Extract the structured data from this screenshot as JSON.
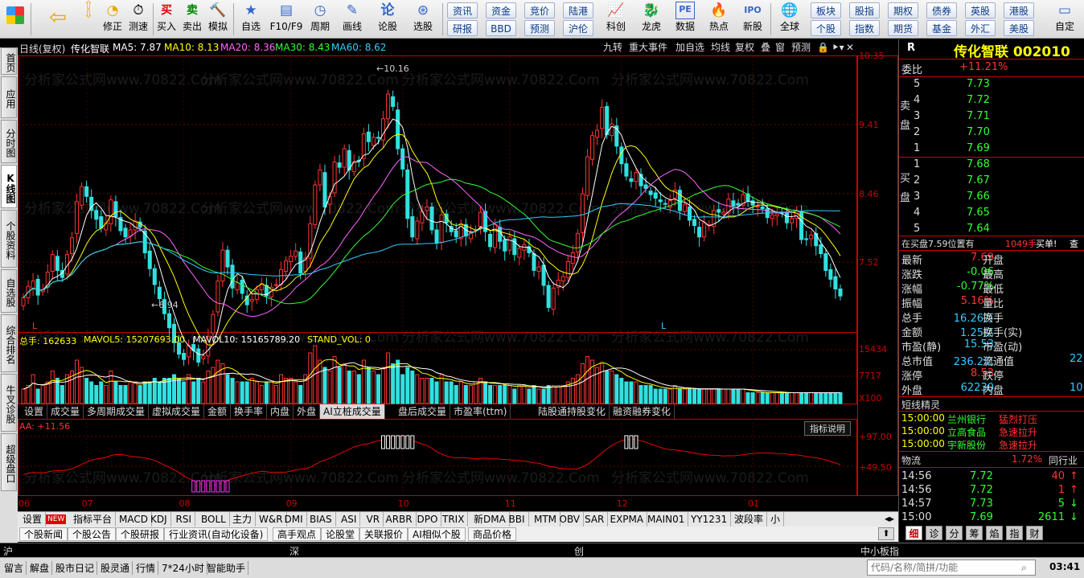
{
  "toolbar": {
    "items": [
      {
        "name": "logo",
        "label": "",
        "icon": "windows-logo"
      },
      {
        "name": "back",
        "label": "",
        "icon": "back-arrow"
      },
      {
        "name": "up-down",
        "label": "修正",
        "icon": "up-down-arrows"
      },
      {
        "name": "fix",
        "label": "修正",
        "icon": "fix-icon"
      },
      {
        "name": "timer",
        "label": "测速",
        "icon": "clock"
      },
      {
        "name": "buy",
        "label": "买入",
        "icon": "buy"
      },
      {
        "name": "sell",
        "label": "卖出",
        "icon": "sell"
      },
      {
        "name": "simulate",
        "label": "模拟",
        "icon": "hammer"
      },
      {
        "name": "watchlist",
        "label": "自选",
        "icon": "star"
      },
      {
        "name": "f10",
        "label": "F10/F9",
        "icon": "f10"
      },
      {
        "name": "period",
        "label": "周期",
        "icon": "clock"
      },
      {
        "name": "draw",
        "label": "画线",
        "icon": "pen"
      },
      {
        "name": "forum",
        "label": "论股",
        "icon": "chat"
      },
      {
        "name": "select",
        "label": "选股",
        "icon": "chart"
      }
    ],
    "quick": [
      "资讯",
      "资金",
      "竞价",
      "陆港",
      "研报",
      "BBD",
      "预测",
      "沪伦"
    ],
    "items2": [
      {
        "name": "kechuang",
        "label": "科创",
        "icon": "kechuang"
      },
      {
        "name": "longhu",
        "label": "龙虎",
        "icon": "dragon"
      },
      {
        "name": "data",
        "label": "数据",
        "icon": "pe"
      },
      {
        "name": "hot",
        "label": "热点",
        "icon": "fire"
      },
      {
        "name": "ipo",
        "label": "新股",
        "icon": "ipo"
      },
      {
        "name": "global",
        "label": "全球",
        "icon": "globe"
      }
    ],
    "quick2": [
      "板块",
      "股指",
      "期权",
      "债券",
      "英股",
      "港股",
      "个股",
      "指数",
      "期货",
      "基金",
      "外汇",
      "美股"
    ],
    "custom": "自定"
  },
  "sidebar": [
    "首页",
    "应用",
    "分时图",
    "K线图",
    "个股资料",
    "自选股",
    "综合排名",
    "牛叉诊股",
    "超级盘口"
  ],
  "chart": {
    "header": {
      "title": "日线(复权)",
      "name": "传化智联",
      "ma5": "MA5: 7.87",
      "ma10": "MA10: 8.13",
      "ma20": "MA20: 8.36",
      "ma30": "MA30: 8.43",
      "ma60": "MA60: 8.62"
    },
    "buttons": [
      "九转",
      "重大事件",
      "加自选",
      "均线",
      "复权",
      "叠",
      "窗",
      "预测"
    ],
    "price_ticks": [
      "10.35",
      "9.41",
      "8.46",
      "7.52"
    ],
    "vol_ticks": [
      "15434",
      "7717",
      "X100"
    ],
    "ind_ticks": [
      "97.00",
      "49.50"
    ],
    "high_label": "10.16",
    "low_label": "6.94",
    "vol_header": {
      "total": "总手: 162633",
      "mavol5": "MAVOL5: 15207693.00",
      "mavol10": "MAVOL10: 15165789.20",
      "stand": "STAND_VOL: 0"
    },
    "ind_header": "AA: +11.56",
    "ind_explain": "指标说明",
    "watermark": "分析家公式网www.70822.Com",
    "month_labels": [
      "06",
      "07",
      "08",
      "09",
      "10",
      "11",
      "12",
      "01"
    ],
    "L_marks": [
      "L",
      "L"
    ],
    "colors": {
      "up": "#ff3333",
      "down": "#33e0e0",
      "ma5": "#ffffff",
      "ma10": "#ffff00",
      "ma20": "#ff66ff",
      "ma30": "#33ff33",
      "ma60": "#33ccff"
    }
  },
  "chart_data": {
    "type": "candlestick",
    "title": "日线(复权)",
    "symbol": "传化智联 002010",
    "ylim": [
      7.3,
      10.4
    ],
    "x": [
      "06",
      "07",
      "08",
      "09",
      "10",
      "11",
      "12",
      "01"
    ],
    "series": [
      {
        "name": "MA5",
        "values": [
          7.87
        ]
      },
      {
        "name": "MA10",
        "values": [
          8.13
        ]
      },
      {
        "name": "MA20",
        "values": [
          8.36
        ]
      },
      {
        "name": "MA30",
        "values": [
          8.43
        ]
      },
      {
        "name": "MA60",
        "values": [
          8.62
        ]
      }
    ],
    "close": [
      7.67,
      7.8,
      7.86,
      7.7,
      7.76,
      7.96,
      8.16,
      7.98,
      7.9,
      8.16,
      8.35,
      8.76,
      8.93,
      8.82,
      8.66,
      8.56,
      8.46,
      8.52,
      8.78,
      8.59,
      8.43,
      8.36,
      8.44,
      8.54,
      8.47,
      8.18,
      8.0,
      7.82,
      7.66,
      7.49,
      7.33,
      7.16,
      7.03,
      6.97,
      7.13,
      7.07,
      6.94,
      7.01,
      7.23,
      7.48,
      7.86,
      8.21,
      8.02,
      7.78,
      7.84,
      7.72,
      7.59,
      7.65,
      7.76,
      7.83,
      7.69,
      7.79,
      7.82,
      7.99,
      8.09,
      8.14,
      8.2,
      7.95,
      8.12,
      8.51,
      8.95,
      9.12,
      8.7,
      8.82,
      9.21,
      9.15,
      9.36,
      9.12,
      9.21,
      9.22,
      9.53,
      9.44,
      9.49,
      9.48,
      9.7,
      9.98,
      9.84,
      9.36,
      9.13,
      8.57,
      8.36,
      8.54,
      8.65,
      8.7,
      8.44,
      8.29,
      8.61,
      8.52,
      8.42,
      8.36,
      8.51,
      8.37,
      8.41,
      8.44,
      8.64,
      8.42,
      8.25,
      8.5,
      8.31,
      8.2,
      8.36,
      8.16,
      8.23,
      8.27,
      8.18,
      7.98,
      8.02,
      7.81,
      7.56,
      7.78,
      7.87,
      7.91,
      8.08,
      8.18,
      8.4,
      8.85,
      9.27,
      9.51,
      9.57,
      9.83,
      9.52,
      9.64,
      9.39,
      9.19,
      9.05,
      8.99,
      9.09,
      8.94,
      8.91,
      8.84,
      8.8,
      8.76,
      8.73,
      8.77,
      8.89,
      8.66,
      8.73,
      8.55,
      8.49,
      8.36,
      8.52,
      8.5,
      8.66,
      8.64,
      8.64,
      8.79,
      8.71,
      8.72,
      8.84,
      8.77,
      8.72,
      8.71,
      8.68,
      8.58,
      8.61,
      8.62,
      8.63,
      8.52,
      8.57,
      8.66,
      8.33,
      8.33,
      8.38,
      8.26,
      8.17,
      7.98,
      7.88,
      7.77,
      7.69
    ],
    "open": [
      7.58,
      7.67,
      7.78,
      7.88,
      7.74,
      7.79,
      7.97,
      8.14,
      7.98,
      7.94,
      8.17,
      8.4,
      8.72,
      8.93,
      8.81,
      8.66,
      8.59,
      8.44,
      8.51,
      8.76,
      8.58,
      8.46,
      8.37,
      8.44,
      8.53,
      8.43,
      8.2,
      8.0,
      7.79,
      7.65,
      7.49,
      7.37,
      7.16,
      7.04,
      7.0,
      7.14,
      7.09,
      6.98,
      7.01,
      7.27,
      7.51,
      7.86,
      8.21,
      8.04,
      7.76,
      7.87,
      7.69,
      7.63,
      7.65,
      7.76,
      7.81,
      7.68,
      7.81,
      7.82,
      7.97,
      8.08,
      8.14,
      8.19,
      7.97,
      8.12,
      8.5,
      8.95,
      9.09,
      8.73,
      8.86,
      9.2,
      9.15,
      9.34,
      9.1,
      9.23,
      9.25,
      9.55,
      9.4,
      9.49,
      9.46,
      9.7,
      9.95,
      9.8,
      9.36,
      9.12,
      8.59,
      8.34,
      8.52,
      8.66,
      8.7,
      8.44,
      8.3,
      8.62,
      8.48,
      8.43,
      8.34,
      8.5,
      8.34,
      8.43,
      8.48,
      8.65,
      8.39,
      8.24,
      8.47,
      8.33,
      8.21,
      8.34,
      8.13,
      8.21,
      8.25,
      8.17,
      7.97,
      8.04,
      7.81,
      7.54,
      7.79,
      7.86,
      7.9,
      8.06,
      8.19,
      8.41,
      8.83,
      9.24,
      9.49,
      9.59,
      9.84,
      9.51,
      9.62,
      9.38,
      9.19,
      9.02,
      8.99,
      9.07,
      8.95,
      8.88,
      8.86,
      8.78,
      8.74,
      8.7,
      8.8,
      8.89,
      8.65,
      8.7,
      8.56,
      8.47,
      8.36,
      8.5,
      8.48,
      8.67,
      8.62,
      8.63,
      8.77,
      8.74,
      8.72,
      8.85,
      8.77,
      8.7,
      8.7,
      8.68,
      8.57,
      8.6,
      8.64,
      8.63,
      8.52,
      8.57,
      8.65,
      8.34,
      8.34,
      8.4,
      8.27,
      8.17,
      7.99,
      7.91,
      7.77
    ],
    "volume": [
      4,
      5,
      8,
      4,
      5,
      6,
      9,
      7,
      5,
      8,
      9,
      12,
      10,
      7,
      6,
      5,
      6,
      5,
      9,
      6,
      5,
      5,
      6,
      6,
      5,
      6,
      6,
      7,
      6,
      7,
      7,
      8,
      7,
      6,
      8,
      6,
      7,
      6,
      9,
      10,
      12,
      11,
      8,
      7,
      6,
      6,
      6,
      7,
      6,
      5,
      6,
      6,
      5,
      8,
      7,
      7,
      6,
      5,
      8,
      14,
      16,
      12,
      10,
      9,
      13,
      10,
      11,
      9,
      9,
      8,
      12,
      10,
      9,
      8,
      10,
      14,
      11,
      12,
      8,
      10,
      9,
      8,
      7,
      7,
      7,
      6,
      8,
      6,
      6,
      5,
      6,
      5,
      5,
      6,
      7,
      6,
      5,
      5,
      5,
      5,
      5,
      4,
      5,
      5,
      4,
      5,
      4,
      4,
      5,
      5,
      5,
      5,
      6,
      7,
      8,
      11,
      13,
      12,
      10,
      11,
      9,
      9,
      8,
      7,
      6,
      6,
      6,
      5,
      5,
      5,
      4,
      4,
      4,
      4,
      5,
      4,
      4,
      4,
      4,
      4,
      4,
      4,
      4,
      4,
      4,
      4,
      4,
      4,
      4,
      3,
      3,
      3,
      3,
      3,
      3,
      3,
      3,
      3,
      3,
      3,
      3,
      3,
      3,
      3,
      3,
      3,
      3,
      3,
      3
    ],
    "indicator": {
      "name": "AA",
      "last": 11.56,
      "levels": [
        97.0,
        49.5
      ]
    }
  },
  "tabs1": [
    "设置",
    "成交量",
    "多周期成交量",
    "虚拟成交量",
    "金额",
    "换手率",
    "内盘",
    "外盘",
    "AI立桩成交量",
    "盘后成交量",
    "市盈率(ttm)",
    "陆股通持股变化",
    "融资融券变化"
  ],
  "tabs1_active": "AI立桩成交量",
  "tabs2": [
    "设置",
    "指标平台",
    "MACD",
    "KDJ",
    "RSI",
    "BOLL",
    "主力",
    "W&R",
    "DMI",
    "BIAS",
    "ASI",
    "VR",
    "ARBR",
    "DPO",
    "TRIX",
    "新DMA",
    "BBI",
    "MTM",
    "OBV",
    "SAR",
    "EXPMA",
    "MAIN01",
    "YY1231",
    "波段率",
    "小"
  ],
  "tabs2_new": "NEW",
  "tabs3": [
    "个股新闻",
    "个股公告",
    "个股研报",
    "行业资讯(自动化设备)",
    "高手观点",
    "论股堂",
    "关联报价",
    "AI相似个股",
    "商品价格"
  ],
  "idxbar": [
    "沪",
    "深",
    "创",
    "中小板指"
  ],
  "statusbar": [
    "留言",
    "解盘",
    "股市日记",
    "股灵通",
    "行情",
    "7*24小时",
    "智能助手"
  ],
  "search_placeholder": "代码/名称/简拼/功能",
  "clock": "03:41",
  "rpanel": {
    "title": "传化智联 002010",
    "weibi_label": "委比",
    "weibi_value": "+11.21%",
    "sell_label": "卖盘",
    "sell": [
      [
        "5",
        "7.73"
      ],
      [
        "4",
        "7.72"
      ],
      [
        "3",
        "7.71"
      ],
      [
        "2",
        "7.70"
      ],
      [
        "1",
        "7.69"
      ]
    ],
    "buy_label": "买盘",
    "buy": [
      [
        "1",
        "7.68"
      ],
      [
        "2",
        "7.67"
      ],
      [
        "3",
        "7.66"
      ],
      [
        "4",
        "7.65"
      ],
      [
        "5",
        "7.64"
      ]
    ],
    "notice": "在买盘7.59位置有",
    "notice_qty": "1049手",
    "notice_type": "买单!",
    "notice_more": "查",
    "quote": [
      [
        "最新",
        "7.69",
        "开盘",
        ""
      ],
      [
        "涨跌",
        "-0.06",
        "最高",
        ""
      ],
      [
        "涨幅",
        "-0.77%",
        "最低",
        ""
      ],
      [
        "振幅",
        "5.16%",
        "量比",
        ""
      ],
      [
        "总手",
        "16.26万",
        "换手",
        ""
      ],
      [
        "金额",
        "1.25亿",
        "换手(实)",
        ""
      ],
      [
        "市盈(静)",
        "15.53",
        "市盈(动)",
        ""
      ],
      [
        "总市值",
        "236.2亿",
        "流通值",
        "22"
      ],
      [
        "涨停",
        "8.53",
        "跌停",
        ""
      ],
      [
        "外盘",
        "62230",
        "内盘",
        "10"
      ]
    ],
    "elves_title": "短线精灵",
    "elves": [
      [
        "15:00:00",
        "兰州银行",
        "猛烈打压"
      ],
      [
        "15:00:00",
        "立高食品",
        "急速拉升"
      ],
      [
        "15:00:00",
        "宇新股份",
        "急速拉升"
      ]
    ],
    "industry_label": "物流",
    "industry_pct": "1.72%",
    "industry_btn": "同行业",
    "ticks": [
      [
        "14:56",
        "7.72",
        "40",
        "up"
      ],
      [
        "14:56",
        "7.72",
        "1",
        "up"
      ],
      [
        "14:57",
        "7.73",
        "5",
        "down"
      ],
      [
        "15:00",
        "7.69",
        "2611",
        "down"
      ]
    ],
    "tabs": [
      "细",
      "诊",
      "分",
      "筹",
      "焰",
      "指",
      "财"
    ],
    "top_r": "R"
  }
}
